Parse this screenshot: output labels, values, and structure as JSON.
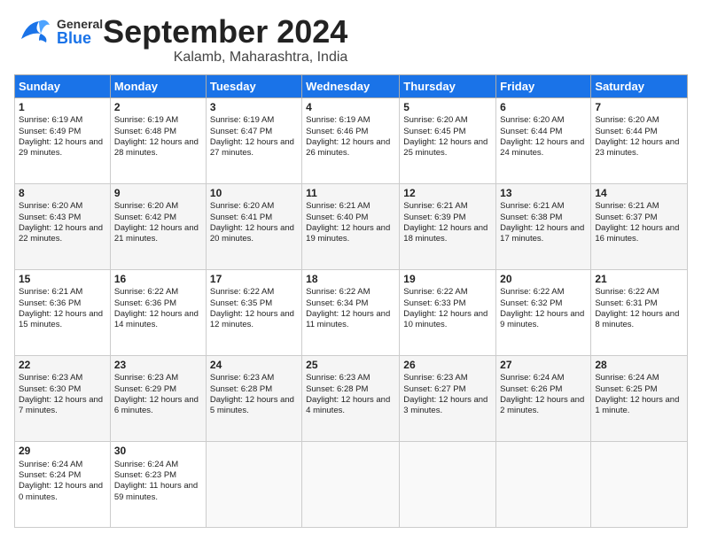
{
  "header": {
    "logo_general": "General",
    "logo_blue": "Blue",
    "month_title": "September 2024",
    "subtitle": "Kalamb, Maharashtra, India"
  },
  "columns": [
    "Sunday",
    "Monday",
    "Tuesday",
    "Wednesday",
    "Thursday",
    "Friday",
    "Saturday"
  ],
  "weeks": [
    [
      {
        "day": "1",
        "sunrise": "Sunrise: 6:19 AM",
        "sunset": "Sunset: 6:49 PM",
        "daylight": "Daylight: 12 hours and 29 minutes."
      },
      {
        "day": "2",
        "sunrise": "Sunrise: 6:19 AM",
        "sunset": "Sunset: 6:48 PM",
        "daylight": "Daylight: 12 hours and 28 minutes."
      },
      {
        "day": "3",
        "sunrise": "Sunrise: 6:19 AM",
        "sunset": "Sunset: 6:47 PM",
        "daylight": "Daylight: 12 hours and 27 minutes."
      },
      {
        "day": "4",
        "sunrise": "Sunrise: 6:19 AM",
        "sunset": "Sunset: 6:46 PM",
        "daylight": "Daylight: 12 hours and 26 minutes."
      },
      {
        "day": "5",
        "sunrise": "Sunrise: 6:20 AM",
        "sunset": "Sunset: 6:45 PM",
        "daylight": "Daylight: 12 hours and 25 minutes."
      },
      {
        "day": "6",
        "sunrise": "Sunrise: 6:20 AM",
        "sunset": "Sunset: 6:44 PM",
        "daylight": "Daylight: 12 hours and 24 minutes."
      },
      {
        "day": "7",
        "sunrise": "Sunrise: 6:20 AM",
        "sunset": "Sunset: 6:44 PM",
        "daylight": "Daylight: 12 hours and 23 minutes."
      }
    ],
    [
      {
        "day": "8",
        "sunrise": "Sunrise: 6:20 AM",
        "sunset": "Sunset: 6:43 PM",
        "daylight": "Daylight: 12 hours and 22 minutes."
      },
      {
        "day": "9",
        "sunrise": "Sunrise: 6:20 AM",
        "sunset": "Sunset: 6:42 PM",
        "daylight": "Daylight: 12 hours and 21 minutes."
      },
      {
        "day": "10",
        "sunrise": "Sunrise: 6:20 AM",
        "sunset": "Sunset: 6:41 PM",
        "daylight": "Daylight: 12 hours and 20 minutes."
      },
      {
        "day": "11",
        "sunrise": "Sunrise: 6:21 AM",
        "sunset": "Sunset: 6:40 PM",
        "daylight": "Daylight: 12 hours and 19 minutes."
      },
      {
        "day": "12",
        "sunrise": "Sunrise: 6:21 AM",
        "sunset": "Sunset: 6:39 PM",
        "daylight": "Daylight: 12 hours and 18 minutes."
      },
      {
        "day": "13",
        "sunrise": "Sunrise: 6:21 AM",
        "sunset": "Sunset: 6:38 PM",
        "daylight": "Daylight: 12 hours and 17 minutes."
      },
      {
        "day": "14",
        "sunrise": "Sunrise: 6:21 AM",
        "sunset": "Sunset: 6:37 PM",
        "daylight": "Daylight: 12 hours and 16 minutes."
      }
    ],
    [
      {
        "day": "15",
        "sunrise": "Sunrise: 6:21 AM",
        "sunset": "Sunset: 6:36 PM",
        "daylight": "Daylight: 12 hours and 15 minutes."
      },
      {
        "day": "16",
        "sunrise": "Sunrise: 6:22 AM",
        "sunset": "Sunset: 6:36 PM",
        "daylight": "Daylight: 12 hours and 14 minutes."
      },
      {
        "day": "17",
        "sunrise": "Sunrise: 6:22 AM",
        "sunset": "Sunset: 6:35 PM",
        "daylight": "Daylight: 12 hours and 12 minutes."
      },
      {
        "day": "18",
        "sunrise": "Sunrise: 6:22 AM",
        "sunset": "Sunset: 6:34 PM",
        "daylight": "Daylight: 12 hours and 11 minutes."
      },
      {
        "day": "19",
        "sunrise": "Sunrise: 6:22 AM",
        "sunset": "Sunset: 6:33 PM",
        "daylight": "Daylight: 12 hours and 10 minutes."
      },
      {
        "day": "20",
        "sunrise": "Sunrise: 6:22 AM",
        "sunset": "Sunset: 6:32 PM",
        "daylight": "Daylight: 12 hours and 9 minutes."
      },
      {
        "day": "21",
        "sunrise": "Sunrise: 6:22 AM",
        "sunset": "Sunset: 6:31 PM",
        "daylight": "Daylight: 12 hours and 8 minutes."
      }
    ],
    [
      {
        "day": "22",
        "sunrise": "Sunrise: 6:23 AM",
        "sunset": "Sunset: 6:30 PM",
        "daylight": "Daylight: 12 hours and 7 minutes."
      },
      {
        "day": "23",
        "sunrise": "Sunrise: 6:23 AM",
        "sunset": "Sunset: 6:29 PM",
        "daylight": "Daylight: 12 hours and 6 minutes."
      },
      {
        "day": "24",
        "sunrise": "Sunrise: 6:23 AM",
        "sunset": "Sunset: 6:28 PM",
        "daylight": "Daylight: 12 hours and 5 minutes."
      },
      {
        "day": "25",
        "sunrise": "Sunrise: 6:23 AM",
        "sunset": "Sunset: 6:28 PM",
        "daylight": "Daylight: 12 hours and 4 minutes."
      },
      {
        "day": "26",
        "sunrise": "Sunrise: 6:23 AM",
        "sunset": "Sunset: 6:27 PM",
        "daylight": "Daylight: 12 hours and 3 minutes."
      },
      {
        "day": "27",
        "sunrise": "Sunrise: 6:24 AM",
        "sunset": "Sunset: 6:26 PM",
        "daylight": "Daylight: 12 hours and 2 minutes."
      },
      {
        "day": "28",
        "sunrise": "Sunrise: 6:24 AM",
        "sunset": "Sunset: 6:25 PM",
        "daylight": "Daylight: 12 hours and 1 minute."
      }
    ],
    [
      {
        "day": "29",
        "sunrise": "Sunrise: 6:24 AM",
        "sunset": "Sunset: 6:24 PM",
        "daylight": "Daylight: 12 hours and 0 minutes."
      },
      {
        "day": "30",
        "sunrise": "Sunrise: 6:24 AM",
        "sunset": "Sunset: 6:23 PM",
        "daylight": "Daylight: 11 hours and 59 minutes."
      },
      {
        "day": "",
        "sunrise": "",
        "sunset": "",
        "daylight": ""
      },
      {
        "day": "",
        "sunrise": "",
        "sunset": "",
        "daylight": ""
      },
      {
        "day": "",
        "sunrise": "",
        "sunset": "",
        "daylight": ""
      },
      {
        "day": "",
        "sunrise": "",
        "sunset": "",
        "daylight": ""
      },
      {
        "day": "",
        "sunrise": "",
        "sunset": "",
        "daylight": ""
      }
    ]
  ]
}
